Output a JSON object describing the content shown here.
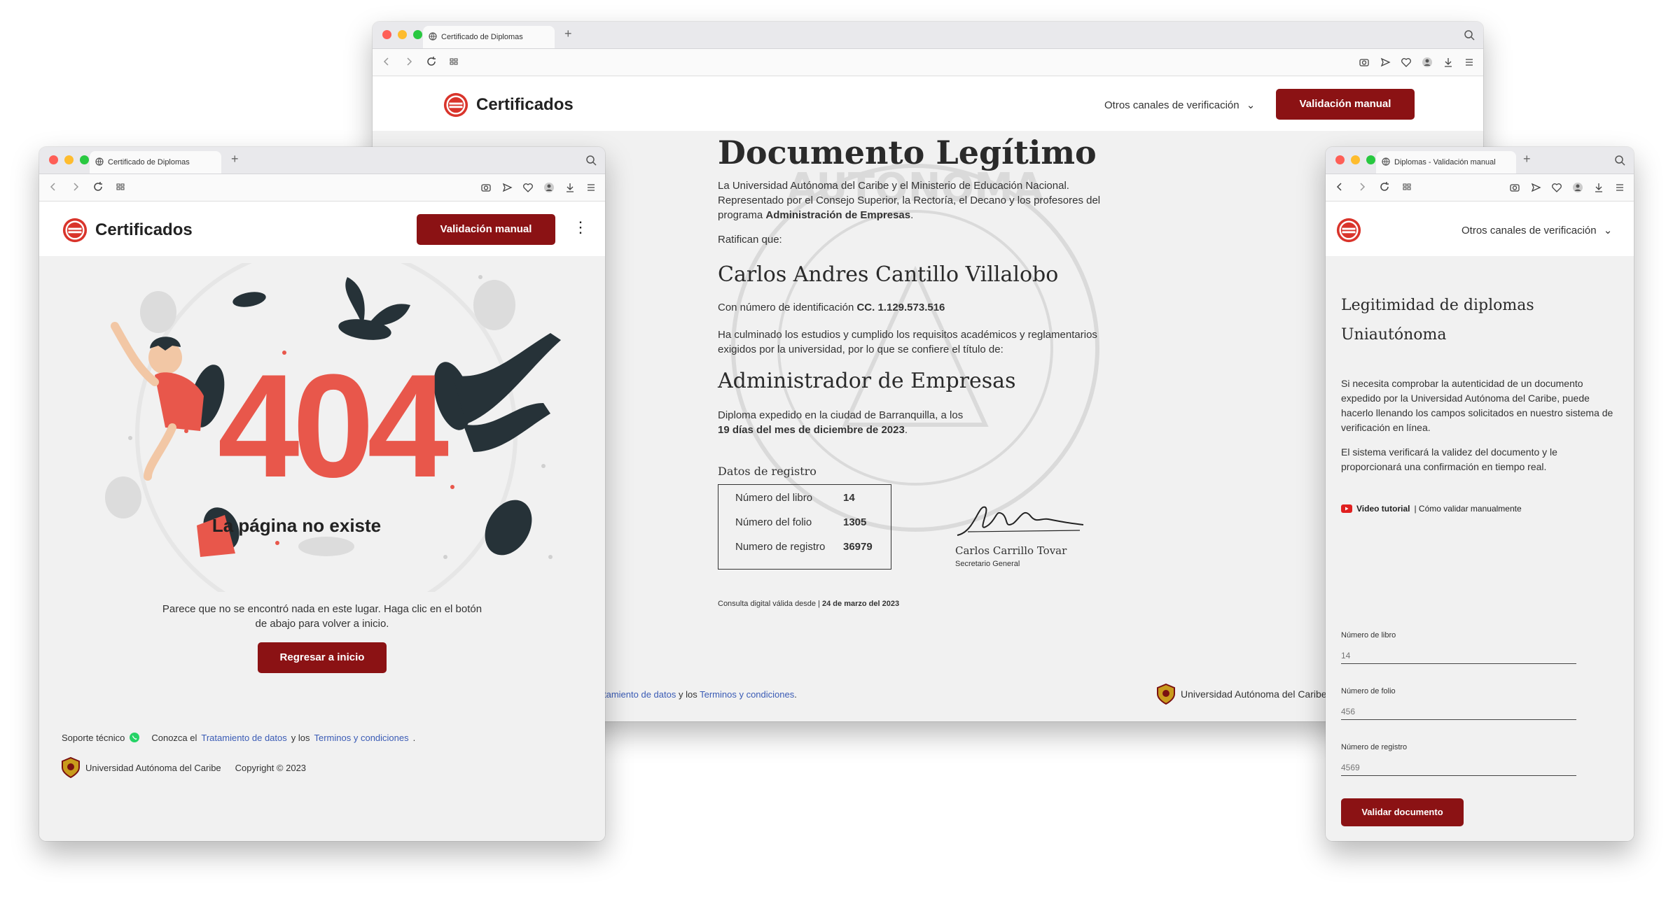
{
  "center_window": {
    "tab_title": "Certificado de Diplomas",
    "brand": "Certificados",
    "other_channels": "Otros canales de verificación",
    "manual_button": "Validación manual",
    "heading": "Documento Legítimo",
    "intro_1": "La Universidad Autónoma del Caribe y el Ministerio de Educación Nacional.",
    "intro_2": "Representado por el Consejo Superior, la Rectoría, el Decano y los profesores del",
    "intro_3_prefix": "programa",
    "intro_3_bold": "Administración de Empresas",
    "ratify": "Ratifican que:",
    "person_name": "Carlos Andres Cantillo Villalobo",
    "id_prefix": "Con número de identificación",
    "id_value": "CC. 1.129.573.516",
    "studies_1": "Ha culminado los estudios y cumplido los requisitos académicos y reglamentarios",
    "studies_2": "exigidos por la universidad, por lo que se confiere el título de:",
    "degree": "Administrador de Empresas",
    "issued_1": "Diploma expedido en la ciudad de Barranquilla, a los",
    "issued_2": "19 días del mes de diciembre de 2023",
    "registry_title": "Datos de registro",
    "registry": [
      {
        "label": "Número del libro",
        "value": "14"
      },
      {
        "label": "Número del folio",
        "value": "1305"
      },
      {
        "label": "Numero de registro",
        "value": "36979"
      }
    ],
    "signer_name": "Carlos Carrillo Tovar",
    "signer_role": "Secretario General",
    "consult_prefix": "Consulta digital válida desde |",
    "consult_date": "24 de marzo del 2023",
    "footer_link1": "tamiento de datos",
    "footer_mid": "y los",
    "footer_link2": "Terminos y condiciones",
    "footer_university": "Universidad Autónoma del Caribe"
  },
  "left_window": {
    "tab_title": "Certificado de Diplomas",
    "brand": "Certificados",
    "manual_button": "Validación manual",
    "error_code": "404",
    "error_title": "La página no existe",
    "error_msg_1": "Parece que no se encontró nada en este lugar. Haga clic en el botón",
    "error_msg_2": "de abajo para volver a inicio.",
    "back_button": "Regresar a inicio",
    "support": "Soporte técnico",
    "conozca": "Conozca el",
    "link1": "Tratamiento de datos",
    "mid": "y los",
    "link2": "Terminos y condiciones",
    "university": "Universidad Autónoma del Caribe",
    "copyright": "Copyright © 2023"
  },
  "right_window": {
    "tab_title": "Diplomas - Validación manual",
    "other_channels": "Otros canales de verificación",
    "heading_1": "Legitimidad de diplomas",
    "heading_2": "Uniautónoma",
    "para_1": "Si necesita comprobar la autenticidad de un documento expedido por la Universidad Autónoma del Caribe, puede hacerlo llenando los campos solicitados en nuestro sistema de verificación en línea.",
    "para_2": "El sistema verificará la validez del documento y le proporcionará una confirmación en tiempo real.",
    "video_bold": "Video tutorial",
    "video_rest": "| Cómo validar manualmente",
    "fields": [
      {
        "label": "Número de libro",
        "placeholder": "14"
      },
      {
        "label": "Número de folio",
        "placeholder": "456"
      },
      {
        "label": "Número de registro",
        "placeholder": "4569"
      }
    ],
    "submit": "Validar documento"
  },
  "colors": {
    "brand_red": "#8b1214",
    "accent_404": "#e8574b",
    "link": "#3a5bb5"
  }
}
